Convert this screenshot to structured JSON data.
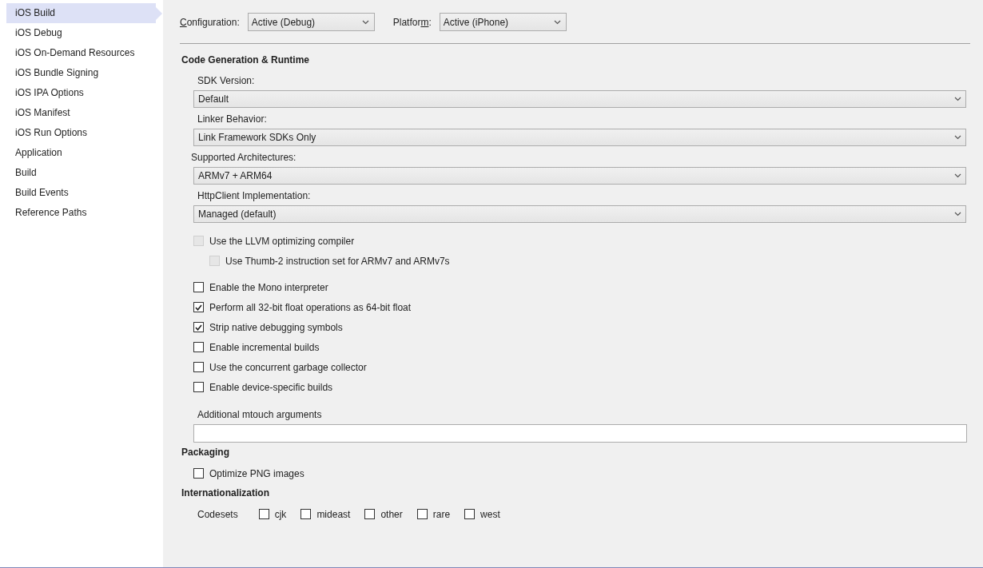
{
  "sidebar": {
    "items": [
      {
        "label": "iOS Build",
        "selected": true
      },
      {
        "label": "iOS Debug",
        "selected": false
      },
      {
        "label": "iOS On-Demand Resources",
        "selected": false
      },
      {
        "label": "iOS Bundle Signing",
        "selected": false
      },
      {
        "label": "iOS IPA Options",
        "selected": false
      },
      {
        "label": "iOS Manifest",
        "selected": false
      },
      {
        "label": "iOS Run Options",
        "selected": false
      },
      {
        "label": "Application",
        "selected": false
      },
      {
        "label": "Build",
        "selected": false
      },
      {
        "label": "Build Events",
        "selected": false
      },
      {
        "label": "Reference Paths",
        "selected": false
      }
    ]
  },
  "toolbar": [
    {
      "label": {
        "key": "C",
        "after": "onfiguration:"
      },
      "value": "Active (Debug)"
    },
    {
      "label": {
        "before": "Platfor",
        "key": "m",
        "after": ":"
      },
      "value": "Active (iPhone)"
    }
  ],
  "sections": [
    {
      "title": "Code Generation & Runtime",
      "groups": [
        [
          {
            "kind": "dropdown",
            "label": "SDK Version:",
            "value": "Default"
          },
          {
            "kind": "dropdown",
            "label": "Linker Behavior:",
            "value": "Link Framework SDKs Only"
          },
          {
            "kind": "dropdown",
            "label": "Supported Architectures:",
            "value": "ARMv7 + ARM64",
            "outdent": true
          },
          {
            "kind": "dropdown",
            "label": "HttpClient Implementation:",
            "value": "Managed (default)"
          }
        ],
        [
          {
            "kind": "checkbox",
            "label": "Use the LLVM optimizing compiler",
            "checked": false,
            "disabled": true,
            "children": [
              {
                "kind": "checkbox",
                "label": "Use Thumb-2 instruction set for ARMv7 and ARMv7s",
                "checked": false,
                "disabled": true
              }
            ]
          }
        ],
        [
          {
            "kind": "checkbox",
            "label": "Enable the Mono interpreter",
            "checked": false,
            "disabled": false
          },
          {
            "kind": "checkbox",
            "label": "Perform all 32-bit float operations as 64-bit float",
            "checked": true,
            "disabled": false
          },
          {
            "kind": "checkbox",
            "label": "Strip native debugging symbols",
            "checked": true,
            "disabled": false
          },
          {
            "kind": "checkbox",
            "label": "Enable incremental builds",
            "checked": false,
            "disabled": false
          },
          {
            "kind": "checkbox",
            "label": "Use the concurrent garbage collector",
            "checked": false,
            "disabled": false
          },
          {
            "kind": "checkbox",
            "label": "Enable device-specific builds",
            "checked": false,
            "disabled": false
          }
        ],
        [
          {
            "kind": "text",
            "label": "Additional mtouch arguments"
          }
        ]
      ]
    },
    {
      "title": "Packaging",
      "groups": [
        [
          {
            "kind": "checkbox",
            "label": "Optimize PNG images",
            "checked": false,
            "disabled": false
          }
        ]
      ]
    },
    {
      "title": "Internationalization",
      "groups": [
        [
          {
            "kind": "options",
            "label": "Codesets",
            "options": [
              {
                "label": "cjk",
                "checked": false
              },
              {
                "label": "mideast",
                "checked": false
              },
              {
                "label": "other",
                "checked": false
              },
              {
                "label": "rare",
                "checked": false
              },
              {
                "label": "west",
                "checked": false
              }
            ]
          }
        ]
      ]
    }
  ]
}
